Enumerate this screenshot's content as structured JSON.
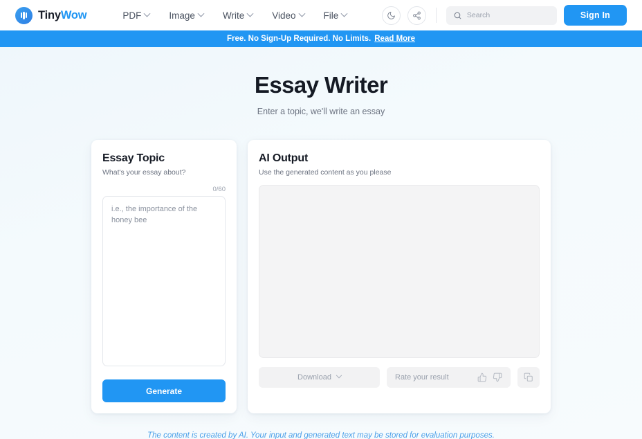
{
  "header": {
    "brand": {
      "name_tiny": "Tiny",
      "name_wow": "Wow",
      "logo_icon": "tinywow-logo-icon"
    },
    "nav": [
      {
        "label": "PDF"
      },
      {
        "label": "Image"
      },
      {
        "label": "Write"
      },
      {
        "label": "Video"
      },
      {
        "label": "File"
      }
    ],
    "dark_mode_icon": "moon-icon",
    "share_icon": "share-icon",
    "search": {
      "placeholder": "Search",
      "value": ""
    },
    "signin_label": "Sign In"
  },
  "banner": {
    "text": "Free. No Sign-Up Required. No Limits.",
    "link_label": "Read More"
  },
  "page": {
    "title": "Essay Writer",
    "subtitle": "Enter a topic, we'll write an essay"
  },
  "input_card": {
    "title": "Essay Topic",
    "subtitle": "What's your essay about?",
    "counter": "0/60",
    "textarea_placeholder": "i.e., the importance of the honey bee",
    "textarea_value": "",
    "generate_label": "Generate"
  },
  "output_card": {
    "title": "AI Output",
    "subtitle": "Use the generated content as you please",
    "output_value": "",
    "download_label": "Download",
    "rate_label": "Rate your result",
    "thumbs_up_icon": "thumbs-up-icon",
    "thumbs_down_icon": "thumbs-down-icon",
    "copy_icon": "copy-icon"
  },
  "footer": {
    "disclaimer": "The content is created by AI. Your input and generated text may be stored for evaluation purposes."
  },
  "colors": {
    "accent": "#2196f3",
    "background": "#f1f8fc",
    "text_dark": "#151a24",
    "text_muted": "#6b7280"
  }
}
